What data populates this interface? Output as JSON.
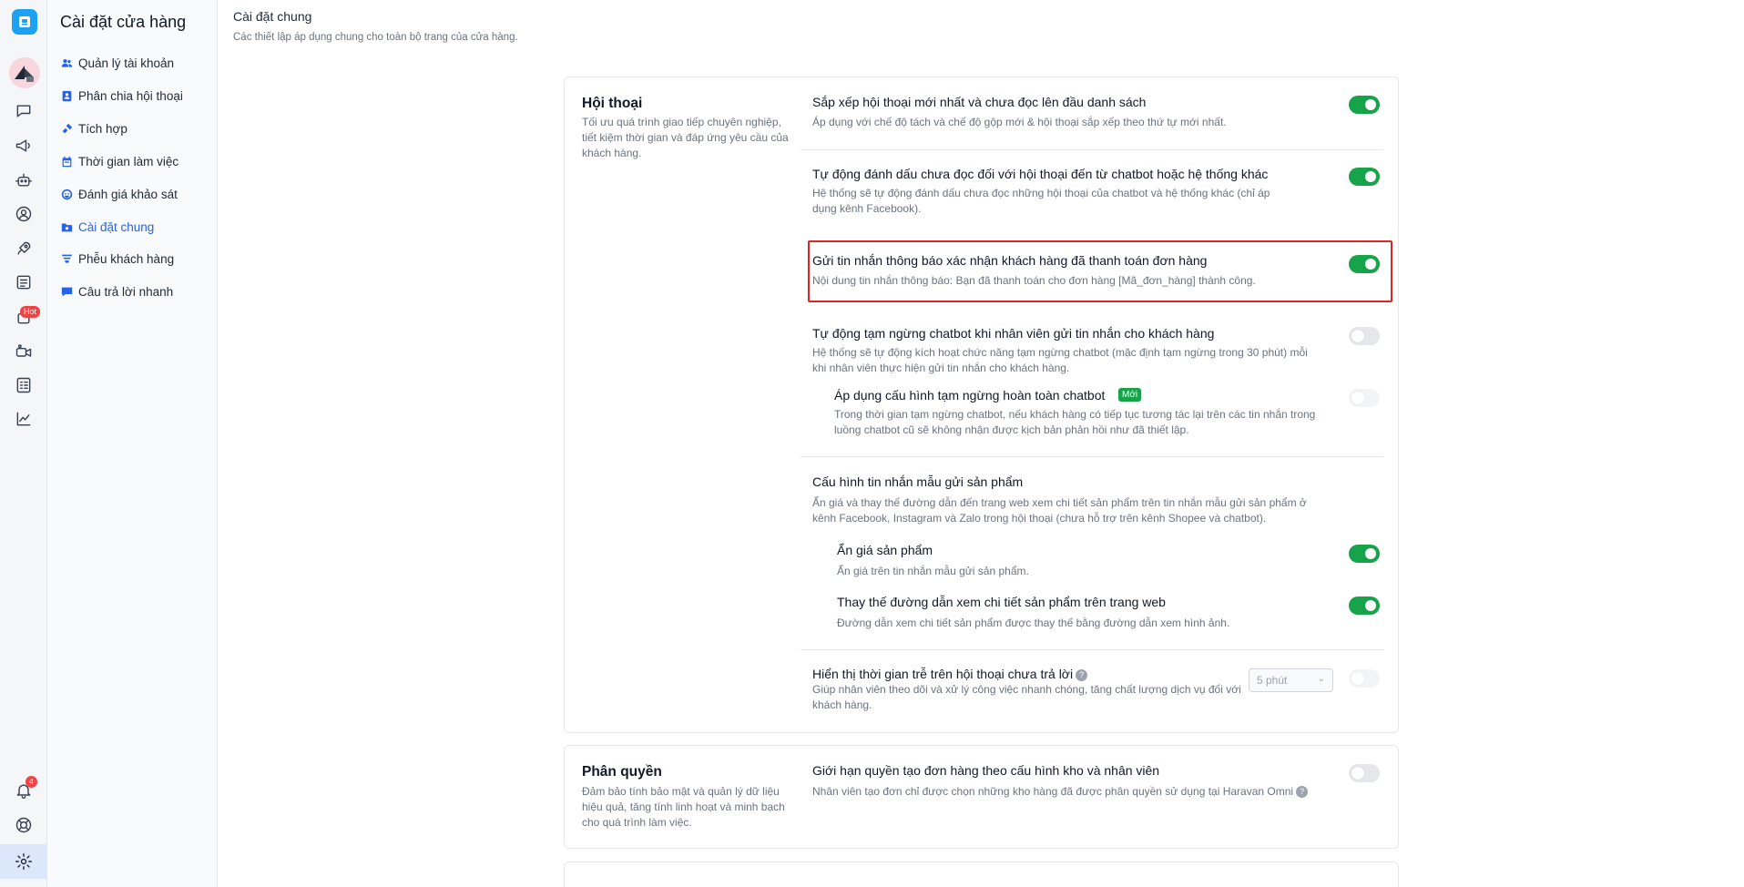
{
  "sidebar": {
    "title": "Cài đặt cửa hàng",
    "items": [
      {
        "label": "Quản lý tài khoản",
        "icon": "users-icon"
      },
      {
        "label": "Phân chia hội thoại",
        "icon": "contact-card-icon"
      },
      {
        "label": "Tích hợp",
        "icon": "plug-icon"
      },
      {
        "label": "Thời gian làm việc",
        "icon": "calendar-icon"
      },
      {
        "label": "Đánh giá khảo sát",
        "icon": "survey-icon"
      },
      {
        "label": "Cài đặt chung",
        "icon": "settings-folder-icon",
        "active": true
      },
      {
        "label": "Phễu khách hàng",
        "icon": "funnel-icon"
      },
      {
        "label": "Câu trả lời nhanh",
        "icon": "chat-bubble-icon"
      }
    ]
  },
  "rail": {
    "hot_badge": "Hot",
    "notification_count": "4"
  },
  "page": {
    "title": "Cài đặt chung",
    "subtitle": "Các thiết lập áp dụng chung cho toàn bộ trang của cửa hàng."
  },
  "conversation": {
    "title": "Hội thoại",
    "description": "Tối ưu quá trình giao tiếp chuyên nghiệp, tiết kiệm thời gian và đáp ứng yêu cầu của khách hàng.",
    "settings": {
      "sort": {
        "title": "Sắp xếp hội thoại mới nhất và chưa đọc lên đầu danh sách",
        "desc": "Áp dụng với chế độ tách và chế độ gộp mới & hội thoại sắp xếp theo thứ tự mới nhất.",
        "enabled": true
      },
      "auto_unread": {
        "title": "Tự động đánh dấu chưa đọc đối với hội thoại đến từ chatbot hoặc hệ thống khác",
        "desc": "Hệ thống sẽ tự động đánh dấu chưa đọc những hội thoại của chatbot và hệ thống khác (chỉ áp dụng kênh Facebook).",
        "enabled": true
      },
      "payment_confirm": {
        "title": "Gửi tin nhắn thông báo xác nhận khách hàng đã thanh toán đơn hàng",
        "desc": "Nội dung tin nhắn thông báo: Bạn đã thanh toán cho đơn hàng [Mã_đơn_hàng] thành công.",
        "enabled": true
      },
      "pause_chatbot": {
        "title": "Tự động tạm ngừng chatbot khi nhân viên gửi tin nhắn cho khách hàng",
        "desc": "Hệ thống sẽ tự động kích hoạt chức năng tạm ngừng chatbot (mặc định tạm ngừng trong 30 phút) mỗi khi nhân viên thực hiện gửi tin nhắn cho khách hàng.",
        "enabled": false
      },
      "full_pause": {
        "title": "Áp dụng cấu hình tạm ngừng hoàn toàn chatbot",
        "badge": "Mới",
        "desc": "Trong thời gian tạm ngừng chatbot, nếu khách hàng có tiếp tục tương tác lại trên các tin nhắn trong luồng chatbot cũ sẽ không nhận được kịch bản phản hồi như đã thiết lập.",
        "enabled": false
      },
      "product_template": {
        "title": "Cấu hình tin nhắn mẫu gửi sản phẩm",
        "desc": "Ẩn giá và thay thế đường dẫn đến trang web xem chi tiết sản phẩm trên tin nhắn mẫu gửi sản phẩm ở kênh Facebook, Instagram và Zalo trong hội thoại (chưa hỗ trợ trên kênh Shopee và chatbot)."
      },
      "hide_price": {
        "title": "Ẩn giá sản phẩm",
        "desc": "Ẩn giá trên tin nhắn mẫu gửi sản phẩm.",
        "enabled": true
      },
      "replace_link": {
        "title": "Thay thế đường dẫn xem chi tiết sản phẩm trên trang web",
        "desc": "Đường dẫn xem chi tiết sản phẩm được thay thế bằng đường dẫn xem hình ảnh.",
        "enabled": true
      },
      "delay_time": {
        "title": "Hiển thị thời gian trễ trên hội thoại chưa trả lời",
        "desc": "Giúp nhân viên theo dõi và xử lý công việc nhanh chóng, tăng chất lượng dịch vụ đối với khách hàng.",
        "select_value": "5 phút",
        "enabled": false
      }
    }
  },
  "permissions": {
    "title": "Phân quyền",
    "description": "Đảm bảo tính bảo mật và quản lý dữ liệu hiệu quả, tăng tính linh hoạt và minh bạch cho quá trình làm việc.",
    "settings": {
      "limit_order": {
        "title": "Giới hạn quyền tạo đơn hàng theo cấu hình kho và nhân viên",
        "desc": "Nhân viên tạo đơn chỉ được chọn những kho hàng đã được phân quyền sử dụng tại Haravan Omni",
        "enabled": false
      }
    }
  },
  "colors": {
    "accent": "#2563eb",
    "toggle_on": "#16a34a",
    "highlight": "#dc2626"
  }
}
